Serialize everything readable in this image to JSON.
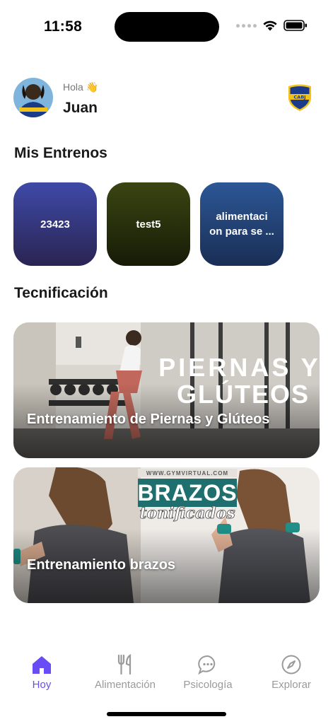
{
  "status_bar": {
    "time": "11:58"
  },
  "header": {
    "greeting": "Hola 👋",
    "user_name": "Juan"
  },
  "sections": {
    "workouts_title": "Mis Entrenos",
    "technique_title": "Tecnificación"
  },
  "workouts": [
    {
      "title": "23423",
      "colors": [
        "#3f4aa8",
        "#2a2452"
      ]
    },
    {
      "title": "test5",
      "colors": [
        "#3a4512",
        "#171b07"
      ]
    },
    {
      "title": "alimentaci on para se ...",
      "colors": [
        "#2c5796",
        "#1a2e55"
      ]
    }
  ],
  "technique": [
    {
      "label": "Entrenamiento de Piernas y Glúteos",
      "overlay_text": [
        "PIERNAS Y",
        "GLÚTEOS"
      ]
    },
    {
      "label": "Entrenamiento brazos",
      "banner_top": "WWW.GYMVIRTUAL.COM",
      "banner_title": "BRAZOS",
      "banner_subtitle": "tonificados"
    }
  ],
  "tabs": [
    {
      "label": "Hoy",
      "icon": "home-icon",
      "active": true
    },
    {
      "label": "Alimentación",
      "icon": "fork-knife-icon",
      "active": false
    },
    {
      "label": "Psicología",
      "icon": "chat-bubble-icon",
      "active": false
    },
    {
      "label": "Explorar",
      "icon": "compass-icon",
      "active": false
    }
  ],
  "colors": {
    "accent": "#6a4cf5",
    "inactive": "#9a9a9a",
    "badge_blue": "#1a3a8a",
    "badge_gold": "#f2c21b"
  }
}
